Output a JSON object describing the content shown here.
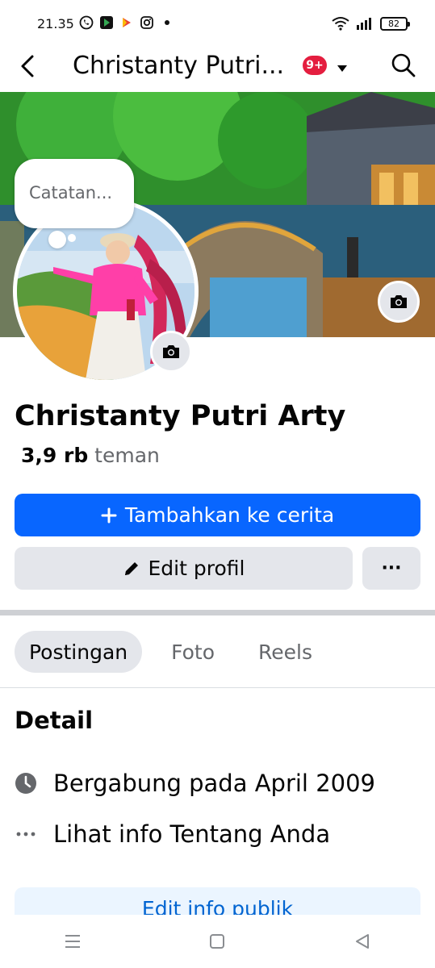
{
  "status_bar": {
    "time": "21.35",
    "battery": "82",
    "apps": [
      "whatsapp-icon",
      "play-store-icon",
      "play-games-icon",
      "instagram-icon"
    ]
  },
  "header": {
    "title": "Christanty Putri...",
    "notification_badge": "9+"
  },
  "note": {
    "text": "Catatan..."
  },
  "profile": {
    "name": "Christanty Putri Arty",
    "friends_count": "3,9 rb",
    "friends_label": "teman"
  },
  "actions": {
    "add_story": "Tambahkan ke cerita",
    "edit_profile": "Edit profil",
    "more": "···"
  },
  "tabs": [
    {
      "label": "Postingan",
      "active": true
    },
    {
      "label": "Foto",
      "active": false
    },
    {
      "label": "Reels",
      "active": false
    }
  ],
  "details": {
    "title": "Detail",
    "joined": "Bergabung pada April 2009",
    "about": "Lihat info Tentang Anda",
    "edit_public": "Edit info publik"
  },
  "colors": {
    "primary": "#0866ff",
    "badge": "#e41e3f",
    "button_gray": "#e4e6eb",
    "secondary_text": "#65676b"
  }
}
